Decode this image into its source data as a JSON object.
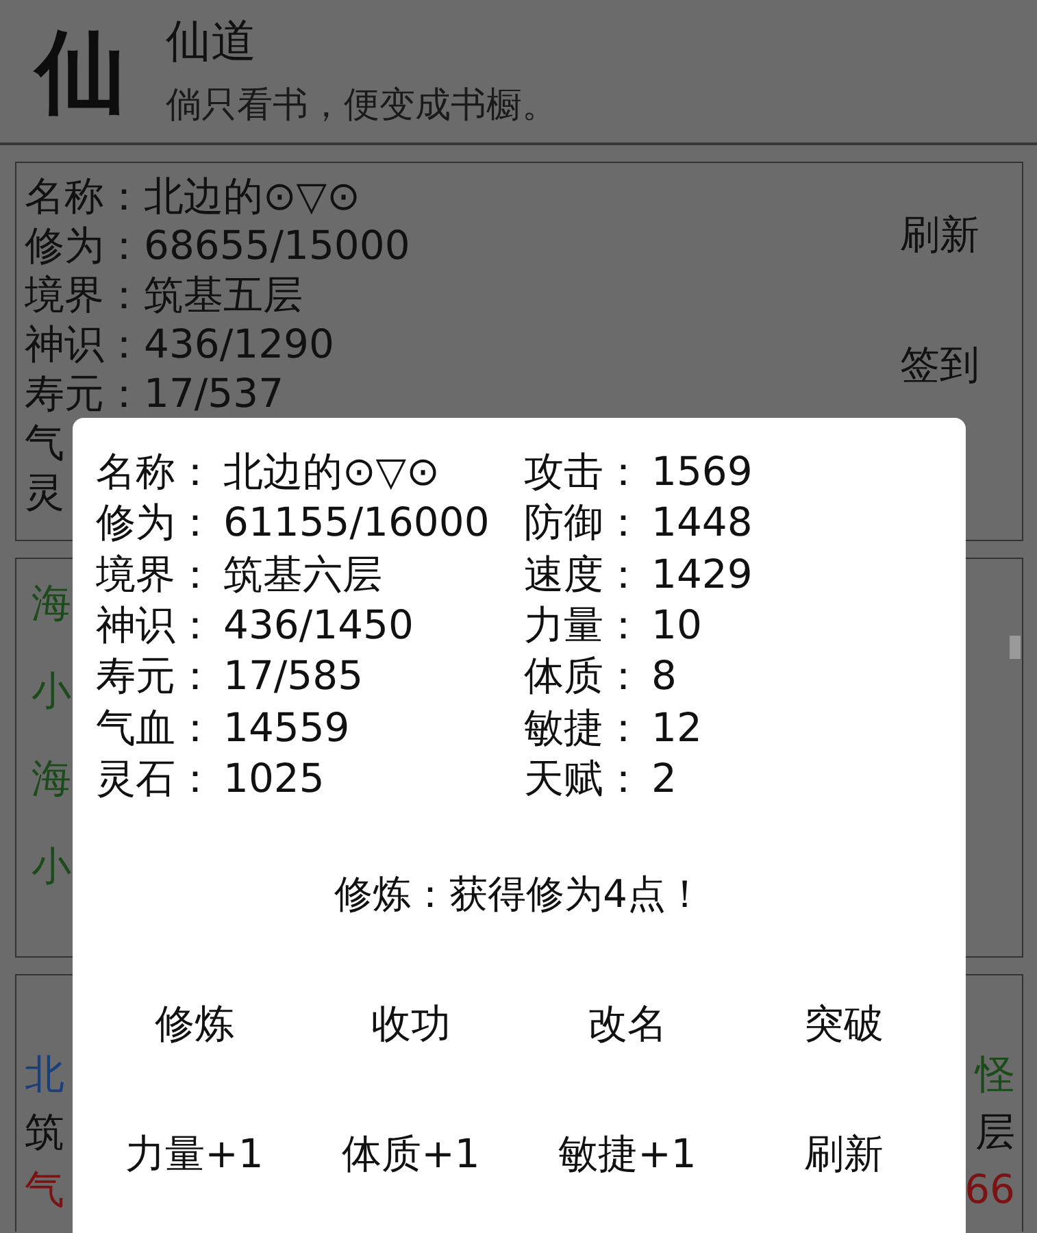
{
  "header": {
    "logo": "仙",
    "title": "仙道",
    "subtitle": "倘只看书，便变成书橱。"
  },
  "profile_card": {
    "lines": [
      "名称：北边的⊙▽⊙",
      "修为：68655/15000",
      "境界：筑基五层",
      "神识：436/1290",
      "寿元：17/537",
      "气",
      "灵"
    ],
    "buttons": [
      "刷新",
      "签到"
    ]
  },
  "list_card": {
    "items": [
      {
        "text": "海",
        "color": "#1b4a1b"
      },
      {
        "text": "小",
        "color": "#1b4a1b"
      },
      {
        "text": "海",
        "color": "#1b4a1b"
      },
      {
        "text": "小",
        "color": "#1b4a1b"
      }
    ]
  },
  "detail_card": {
    "rows": [
      {
        "left": {
          "text": "北",
          "color": "#19407a"
        },
        "right": {
          "text": "怪",
          "color": "#1b4a1b"
        }
      },
      {
        "left": {
          "text": "筑",
          "color": "#111111"
        },
        "right": {
          "text": "层",
          "color": "#111111"
        }
      },
      {
        "left": {
          "text": "气",
          "color": "#7a1414"
        },
        "right": {
          "text": "66",
          "color": "#7a1414"
        }
      }
    ]
  },
  "dialog": {
    "stats_left": [
      {
        "label": "名称：",
        "value": "北边的⊙▽⊙"
      },
      {
        "label": "修为：",
        "value": "61155/16000"
      },
      {
        "label": "境界：",
        "value": "筑基六层"
      },
      {
        "label": "神识：",
        "value": "436/1450"
      },
      {
        "label": "寿元：",
        "value": "17/585"
      },
      {
        "label": "气血：",
        "value": "14559"
      },
      {
        "label": "灵石：",
        "value": "1025"
      }
    ],
    "stats_right": [
      {
        "label": "攻击：",
        "value": "1569"
      },
      {
        "label": "防御：",
        "value": "1448"
      },
      {
        "label": "速度：",
        "value": "1429"
      },
      {
        "label": "力量：",
        "value": "10"
      },
      {
        "label": "体质：",
        "value": "8"
      },
      {
        "label": "敏捷：",
        "value": "12"
      },
      {
        "label": "天赋：",
        "value": "2"
      }
    ],
    "message": "修炼：获得修为4点！",
    "buttons": [
      [
        "修炼",
        "收功",
        "改名",
        "突破"
      ],
      [
        "力量+1",
        "体质+1",
        "敏捷+1",
        "刷新"
      ]
    ]
  }
}
